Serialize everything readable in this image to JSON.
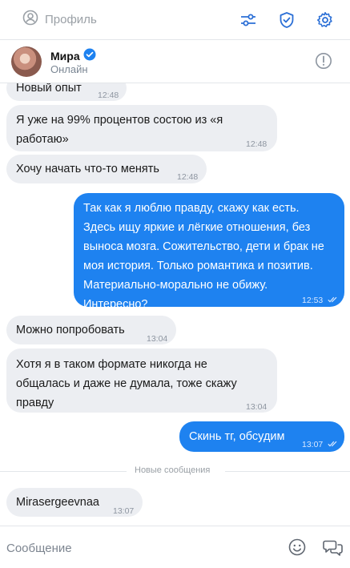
{
  "topbar": {
    "profile_label": "Профиль",
    "icons": [
      "filters-icon",
      "shield-check-icon",
      "gear-icon"
    ]
  },
  "chat": {
    "contact_name": "Мира",
    "contact_status": "Онлайн",
    "verified": true
  },
  "messages": [
    {
      "dir": "in",
      "text": "Новый опыт",
      "time": "12:48"
    },
    {
      "dir": "in",
      "text": "Я уже на 99% процентов состою из «я\nработаю»",
      "time": "12:48"
    },
    {
      "dir": "in",
      "text": "Хочу начать что-то менять",
      "time": "12:48"
    },
    {
      "dir": "out",
      "text": "Так как я люблю правду, скажу как есть.\nЗдесь ищу яркие и лёгкие отношения, без\nвыноса мозга. Сожительство, дети и брак не\nмоя история. Только романтика и позитив.\nМатериально-морально не обижу.\nИнтересно?",
      "time": "12:53",
      "read": true
    },
    {
      "dir": "in",
      "text": "Можно попробовать",
      "time": "13:04"
    },
    {
      "dir": "in",
      "text": "Хотя я в таком формате никогда не\nобщалась и даже не думала, тоже скажу\nправду",
      "time": "13:04"
    },
    {
      "dir": "out",
      "text": "Скинь тг, обсудим",
      "time": "13:07",
      "read": true
    },
    {
      "dir": "in",
      "text": "Mirasergeevnaa",
      "time": "13:07"
    }
  ],
  "new_messages_divider": "Новые сообщения",
  "composer": {
    "placeholder": "Сообщение"
  },
  "colors": {
    "accent": "#1e82f0",
    "incoming_bubble": "#eceef2",
    "icon_blue": "#2b6fd6"
  }
}
